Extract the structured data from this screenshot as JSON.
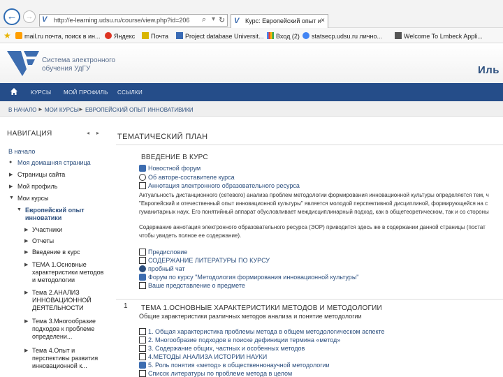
{
  "browser": {
    "url": "http://e-learning.udsu.ru/course/view.php?id=206",
    "tab_title": "Курс: Европейский опыт ин...",
    "bookmarks": [
      {
        "label": "mail.ru почта, поиск в ин..."
      },
      {
        "label": "Яндекс"
      },
      {
        "label": "Почта"
      },
      {
        "label": "Project database Universit..."
      },
      {
        "label": "Вход (2)"
      },
      {
        "label": "statsecp.udsu.ru лично..."
      },
      {
        "label": "Welcome To Lmbeck Appli..."
      }
    ]
  },
  "header": {
    "logo_text": "Система электронного обучения УдГУ",
    "user_name": "Иль"
  },
  "navbar": {
    "items": [
      "Курсы",
      "Мой профиль",
      "Ссылки"
    ]
  },
  "breadcrumb": [
    "В начало",
    "Мои курсы",
    "Европейский опыт инновативики"
  ],
  "navigation": {
    "title": "НАВИГАЦИЯ",
    "home": "В начало",
    "dashboard": "Моя домашняя страница",
    "site_pages": "Страницы сайта",
    "profile": "Мой профиль",
    "my_courses": "Мои курсы",
    "current_course": "Европейский опыт инноватики",
    "participants": "Участники",
    "reports": "Отчеты",
    "intro": "Введение в курс",
    "topic1": "ТЕМА 1.Основные характеристики методов и методологии",
    "topic2": "Тема 2.АНАЛИЗ ИННОВАЦИОННОЙ ДЕЯТЕЛЬНОСТИ",
    "topic3": "Тема 3.Многообразие подходов к проблеме определени...",
    "topic4": "Тема 4.Опыт и перспективы развития инновационной к..."
  },
  "main": {
    "title": "ТЕМАТИЧЕСКИЙ ПЛАН",
    "section0": {
      "name": "ВВЕДЕНИЕ В КУРС",
      "activities_top": [
        "Новостной форум",
        "Об авторе-составителе курса",
        "Аннотация электронного образовательного ресурса"
      ],
      "para1": [
        "Актуальность дистанционного (сетевого) анализа проблем методологии формирования инновационной культуры определяется тем, ч",
        "\"Европейский и отечественный опыт инновационной культуры\" является молодой перспективной дисциплиной, формирующейся на с",
        "гуманитарных наук. Его понятийный аппарат обусловливает междисциплинарный подход, как в общетеоретическом, так и со стороны"
      ],
      "para2": [
        "Содержание аннотация электронного образовательного ресурса (ЭОР) приводится здесь же в содержании данной страницы (постат",
        "чтобы увидеть полное ее содержание)."
      ],
      "activities_bottom": [
        "Предисловие",
        "СОДЕРЖАНИЕ ЛИТЕРАТУРЫ ПО КУРСУ",
        "пробный чат",
        "Форум по курсу \"Методология формирования инновационной культуры\"",
        "Ваше представление о предмете"
      ]
    },
    "section1": {
      "num": "1",
      "name": "ТЕМА 1.ОСНОВНЫЕ ХАРАКТЕРИСТИКИ МЕТОДОВ И МЕТОДОЛОГИИ",
      "summary": "Общие характеристики различных методов анализа и понятие методологии",
      "activities": [
        "1. Общая характеристика проблемы метода в общем методологическом аспекте",
        "2. Многообразие подходов в поиске дефиниции термина «метод»",
        "3. Содержание общих, частных и особенных методов",
        "4.МЕТОДЫ АНАЛИЗА ИСТОРИИ НАУКИ",
        "5. Роль понятия «метод» в общественнонаучной методологии",
        "Список литературы по проблеме метода в целом"
      ]
    }
  },
  "colors": {
    "navbar": "#254d89",
    "link": "#2b4e7d",
    "logo": "#3d6db0"
  }
}
